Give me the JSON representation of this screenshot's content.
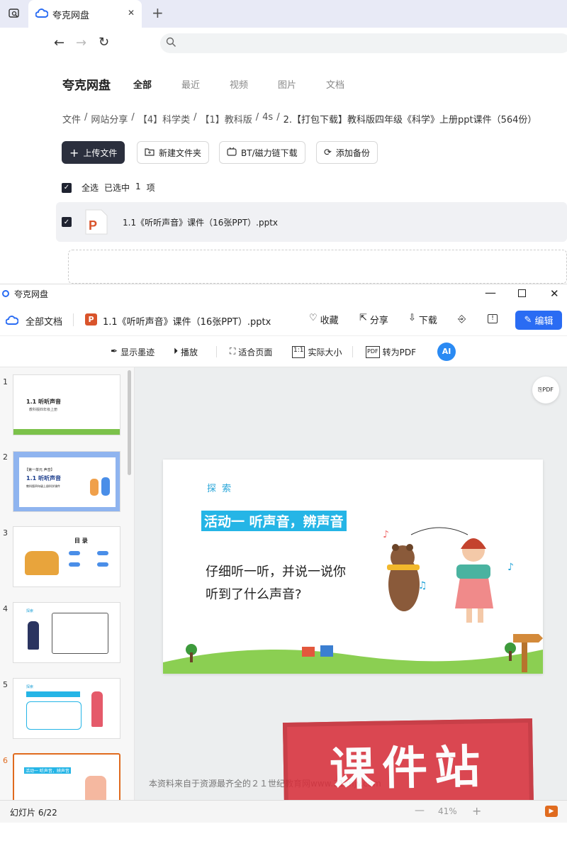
{
  "browser": {
    "tab_title": "夸克网盘",
    "new_tab": "+",
    "close": "✕"
  },
  "app": {
    "logo": "夸克网盘",
    "tabs": [
      "全部",
      "最近",
      "视频",
      "图片",
      "文档"
    ],
    "breadcrumb": [
      "文件",
      "网站分享",
      "【4】科学类",
      "【1】教科版",
      "4s",
      "2.【打包下载】教科版四年级《科学》上册ppt课件（564份）"
    ],
    "actions": {
      "upload": "上传文件",
      "new_folder": "新建文件夹",
      "bt": "BT/磁力链下载",
      "backup": "添加备份"
    },
    "selection": {
      "select_all": "全选",
      "selected": "已选中",
      "count": "1",
      "unit": "项"
    },
    "file_name": "1.1《听听声音》课件（16张PPT）.pptx"
  },
  "viewer": {
    "window_title": "夸克网盘",
    "all_docs": "全部文档",
    "doc_title": "1.1《听听声音》课件（16张PPT）.pptx",
    "actions": {
      "favorite": "收藏",
      "share": "分享",
      "download": "下载",
      "edit": "编辑"
    },
    "toolbar": {
      "ink": "显示墨迹",
      "play": "播放",
      "fit": "适合页面",
      "actual": "实际大小",
      "pdf": "转为PDF",
      "ai": "AI"
    },
    "thumbs": [
      {
        "n": "1",
        "title": "1.1 听听声音",
        "sub": "教科版四年级上册"
      },
      {
        "n": "2",
        "title": "1.1 听听声音",
        "sub": "教科版四年级上册科学课件",
        "tag": "【第一单元  声音】"
      },
      {
        "n": "3",
        "title": "目 录"
      },
      {
        "n": "4",
        "title": "探索"
      },
      {
        "n": "5",
        "title": "探索"
      },
      {
        "n": "6",
        "title": "活动一  听声音，辨声音"
      }
    ],
    "slide": {
      "tag": "探 索",
      "heading": "活动一  听声音，辨声音",
      "line1": "仔细听一听，并说一说你",
      "line2": "听到了什么声音?"
    },
    "watermark_text": "本资料来自于资源最齐全的２１世纪教育网www.21cnjy.com",
    "stamp": "课件站",
    "status": "幻灯片 6/22",
    "zoom": "41%"
  },
  "colors": {
    "accent": "#2a6cf3",
    "dark": "#2b2f3d",
    "banner": "#25b5e6",
    "stamp": "#d8303c"
  }
}
